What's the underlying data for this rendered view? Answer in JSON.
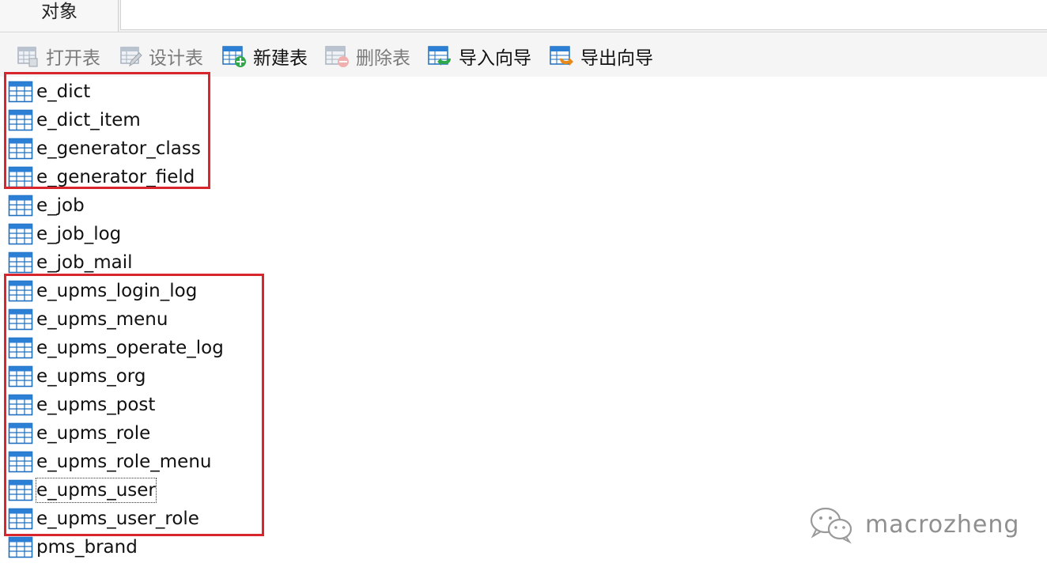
{
  "tab": {
    "label": "对象"
  },
  "toolbar": {
    "items": [
      {
        "label": "打开表",
        "icon": "open-table-icon",
        "enabled": false
      },
      {
        "label": "设计表",
        "icon": "design-table-icon",
        "enabled": false
      },
      {
        "label": "新建表",
        "icon": "new-table-icon",
        "enabled": true
      },
      {
        "label": "删除表",
        "icon": "delete-table-icon",
        "enabled": false
      },
      {
        "label": "导入向导",
        "icon": "import-wizard-icon",
        "enabled": true
      },
      {
        "label": "导出向导",
        "icon": "export-wizard-icon",
        "enabled": true
      }
    ]
  },
  "tables": [
    "e_dict",
    "e_dict_item",
    "e_generator_class",
    "e_generator_field",
    "e_job",
    "e_job_log",
    "e_job_mail",
    "e_upms_login_log",
    "e_upms_menu",
    "e_upms_operate_log",
    "e_upms_org",
    "e_upms_post",
    "e_upms_role",
    "e_upms_role_menu",
    "e_upms_user",
    "e_upms_user_role",
    "pms_brand"
  ],
  "focused_table": "e_upms_user",
  "watermark": {
    "text": "macrozheng",
    "icon": "wechat-icon"
  },
  "colors": {
    "annotation": "#d9262c",
    "table_icon": "#2b7fd4"
  }
}
